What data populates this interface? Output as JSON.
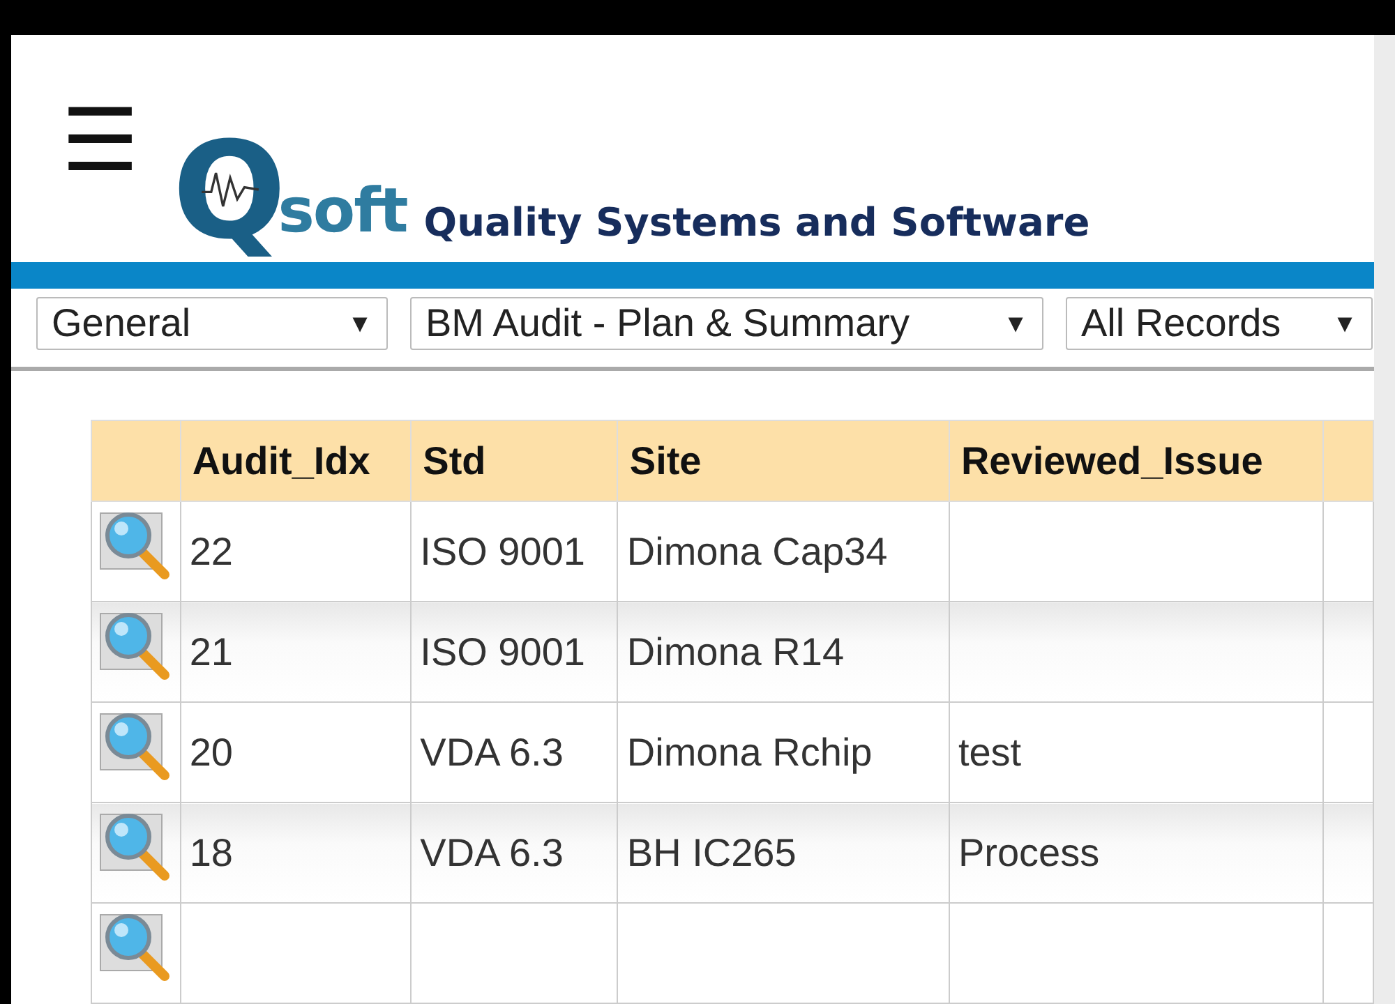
{
  "header": {
    "menu_icon": "☰",
    "logo": {
      "mark": "Q",
      "word": "soft"
    },
    "tagline": "Quality Systems and Software"
  },
  "filters": [
    {
      "value": "General",
      "caret": "▼"
    },
    {
      "value": "BM Audit - Plan & Summary",
      "caret": "▼"
    },
    {
      "value": "All Records",
      "caret": "▼"
    }
  ],
  "table": {
    "columns": [
      "Audit_Idx",
      "Std",
      "Site",
      "Reviewed_Issue"
    ],
    "rows": [
      [
        "22",
        "ISO 9001",
        "Dimona Cap34",
        ""
      ],
      [
        "21",
        "ISO 9001",
        "Dimona R14",
        ""
      ],
      [
        "20",
        "VDA 6.3",
        "Dimona Rchip",
        "test"
      ],
      [
        "18",
        "VDA 6.3",
        "BH IC265",
        "Process"
      ]
    ]
  }
}
